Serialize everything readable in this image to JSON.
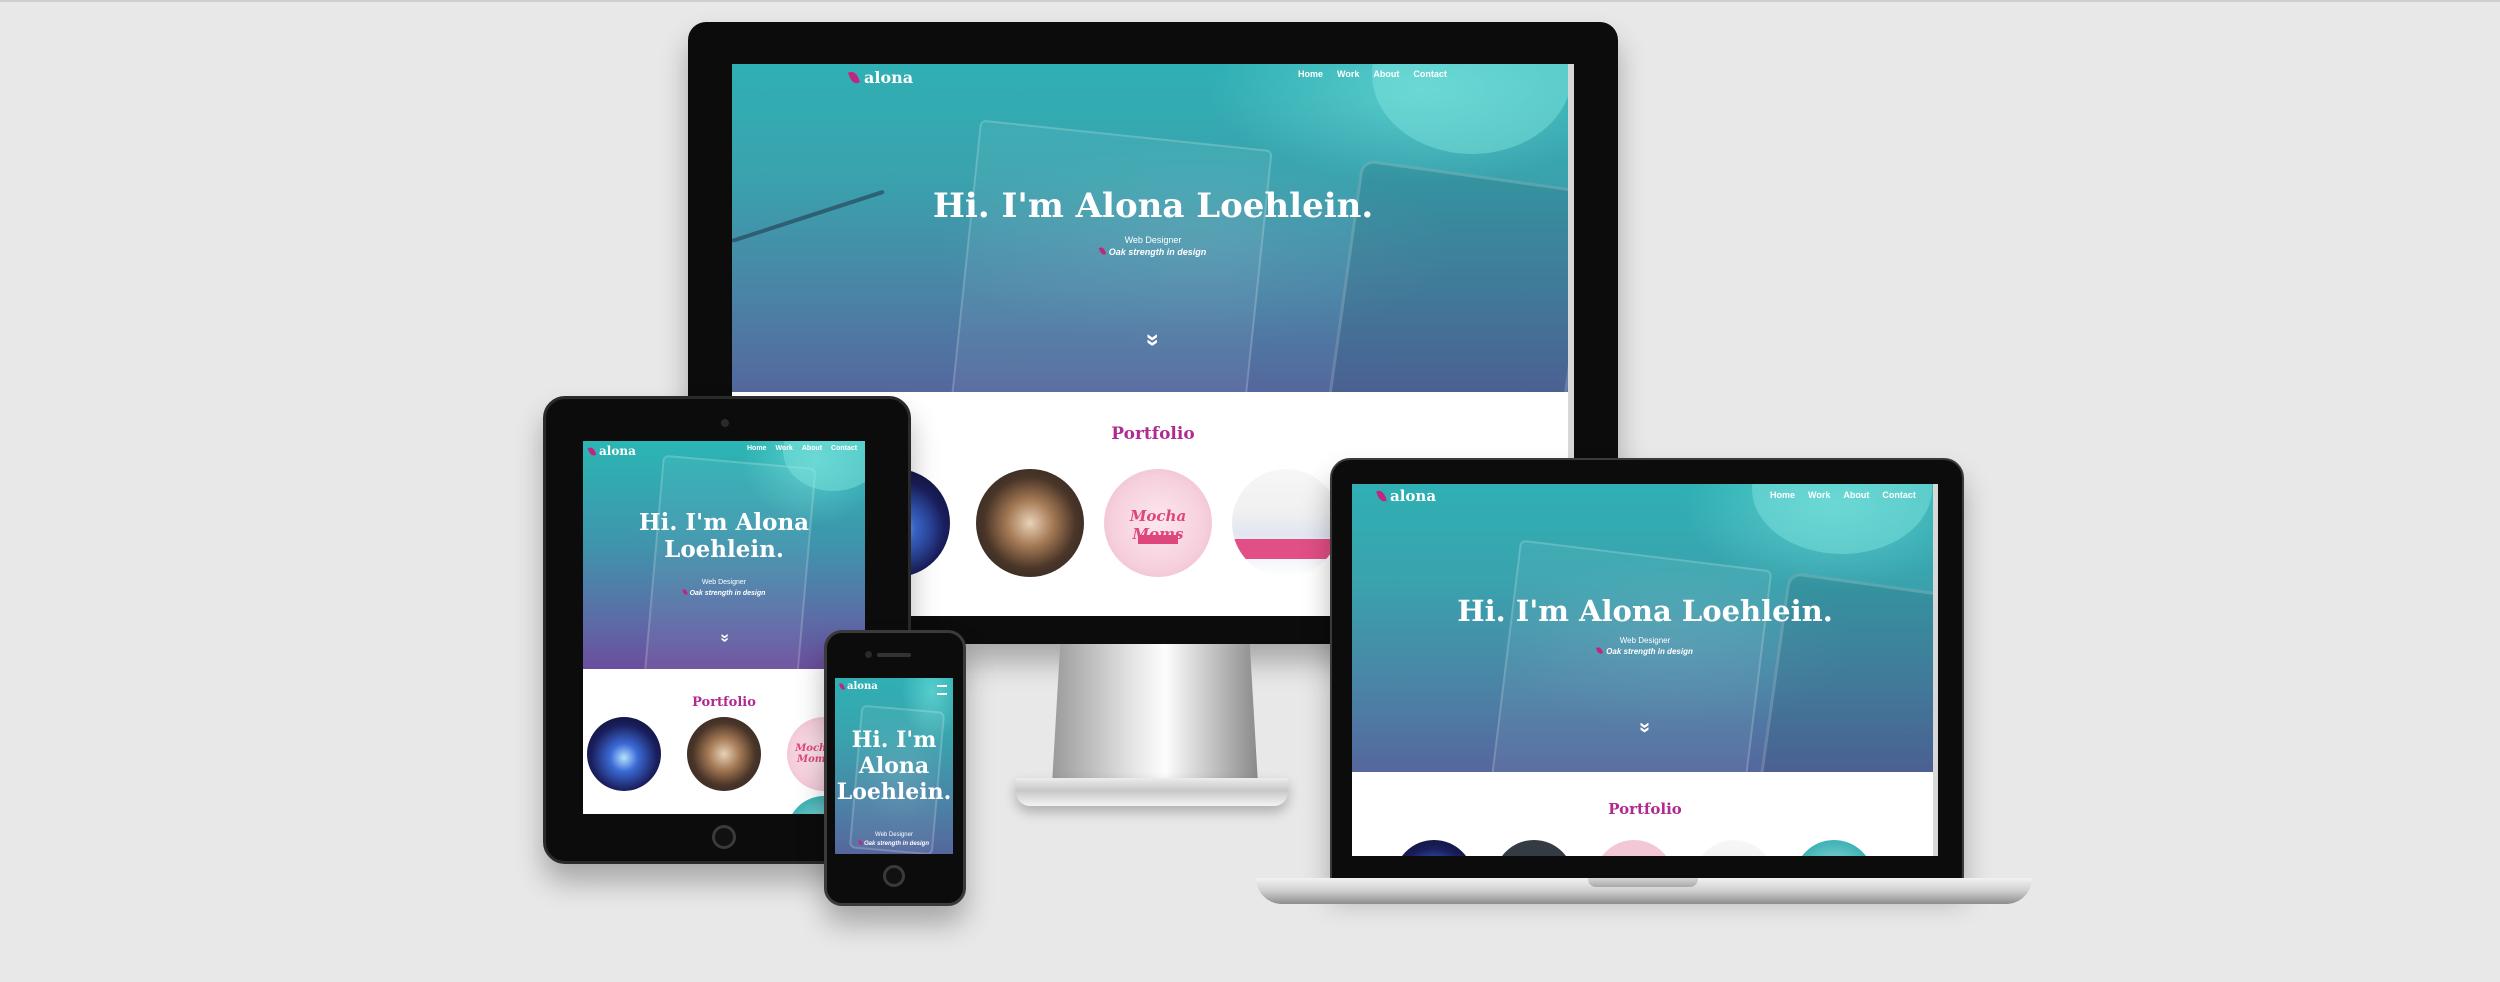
{
  "site": {
    "logo_text": "alona",
    "nav": [
      "Home",
      "Work",
      "About",
      "Contact"
    ],
    "hero_title": "Hi. I'm Alona Loehlein.",
    "hero_title_tablet_line1": "Hi. I'm Alona",
    "hero_title_tablet_line2": "Loehlein.",
    "hero_title_phone_line1": "Hi. I'm",
    "hero_title_phone_line2": "Alona",
    "hero_title_phone_line3": "Loehlein.",
    "subtitle": "Web Designer",
    "tagline": "Oak strength in design",
    "scroll_indicator": "»",
    "portfolio_title": "Portfolio",
    "mocha_label": "Mocha Moms",
    "phone_menu_icon": "hamburger-icon"
  },
  "colors": {
    "background": "#e8e8e8",
    "accent": "#b02a8f",
    "leaf": "#c0267e",
    "hero_top": "#2fb0b4",
    "hero_bottom": "#55679e"
  }
}
